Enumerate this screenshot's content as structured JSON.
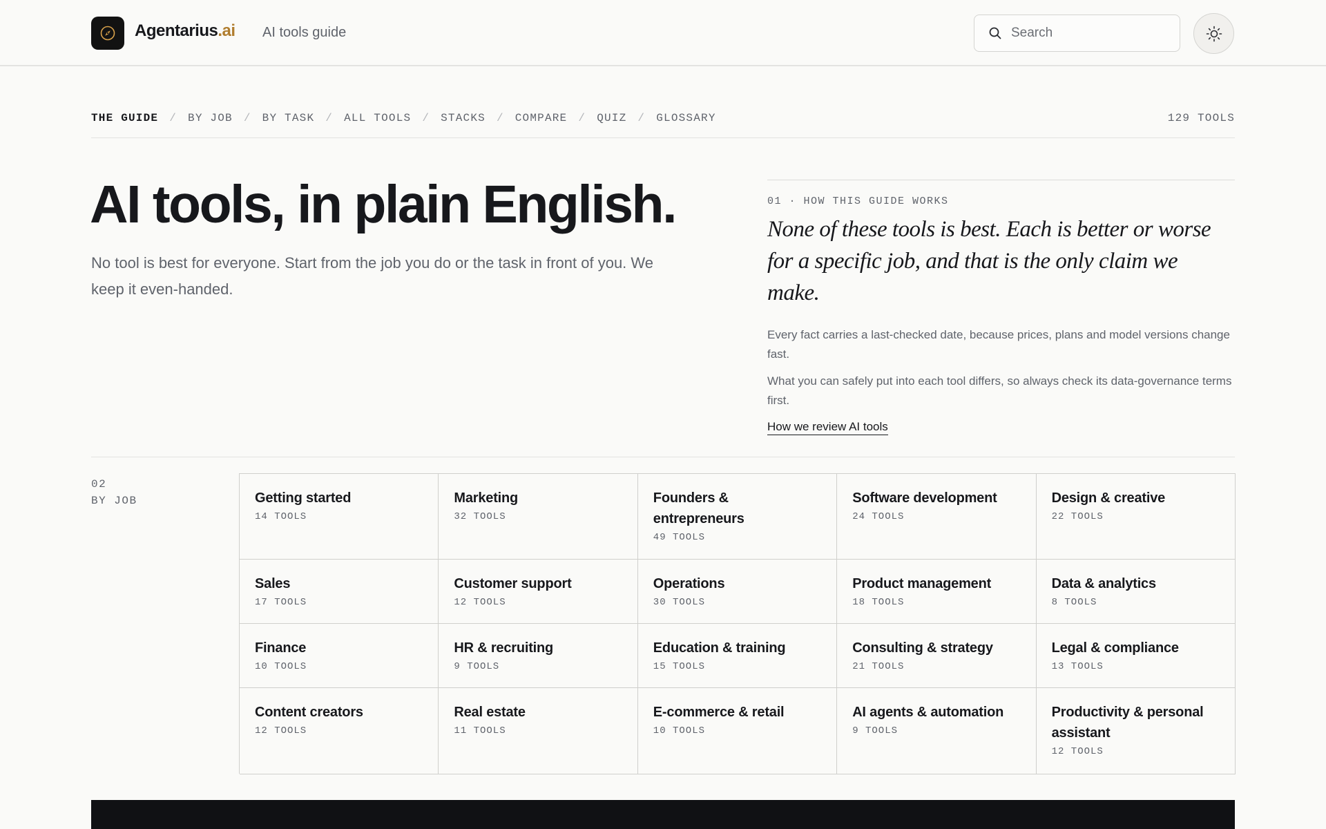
{
  "header": {
    "brand_name": "Agentarius",
    "brand_tld": ".ai",
    "subtitle": "AI tools guide",
    "search_placeholder": "Search",
    "logo_icon": "compass-icon",
    "search_icon": "search-icon",
    "theme_icon": "sun-icon"
  },
  "subnav": {
    "items": [
      {
        "label": "THE GUIDE",
        "active": true
      },
      {
        "label": "BY JOB",
        "active": false
      },
      {
        "label": "BY TASK",
        "active": false
      },
      {
        "label": "ALL TOOLS",
        "active": false
      },
      {
        "label": "STACKS",
        "active": false
      },
      {
        "label": "COMPARE",
        "active": false
      },
      {
        "label": "QUIZ",
        "active": false
      },
      {
        "label": "GLOSSARY",
        "active": false
      }
    ],
    "separator": "/",
    "tool_count": "129 TOOLS"
  },
  "hero": {
    "title": "AI tools, in plain English.",
    "lead": "No tool is best for everyone. Start from the job you do or the task in front of you. We keep it even-handed."
  },
  "how": {
    "eyebrow": "01 · HOW THIS GUIDE WORKS",
    "quote": "None of these tools is best. Each is better or worse for a specific job, and that is the only claim we make.",
    "p1": "Every fact carries a last-checked date, because prices, plans and model versions change fast.",
    "p2": "What you can safely put into each tool differs, so always check its data-governance terms first.",
    "link": "How we review AI tools"
  },
  "by_job": {
    "number": "02",
    "label": "BY JOB",
    "jobs": [
      {
        "name": "Getting started",
        "count": "14 TOOLS"
      },
      {
        "name": "Marketing",
        "count": "32 TOOLS"
      },
      {
        "name": "Founders & entrepreneurs",
        "count": "49 TOOLS"
      },
      {
        "name": "Software development",
        "count": "24 TOOLS"
      },
      {
        "name": "Design & creative",
        "count": "22 TOOLS"
      },
      {
        "name": "Sales",
        "count": "17 TOOLS"
      },
      {
        "name": "Customer support",
        "count": "12 TOOLS"
      },
      {
        "name": "Operations",
        "count": "30 TOOLS"
      },
      {
        "name": "Product management",
        "count": "18 TOOLS"
      },
      {
        "name": "Data & analytics",
        "count": "8 TOOLS"
      },
      {
        "name": "Finance",
        "count": "10 TOOLS"
      },
      {
        "name": "HR & recruiting",
        "count": "9 TOOLS"
      },
      {
        "name": "Education & training",
        "count": "15 TOOLS"
      },
      {
        "name": "Consulting & strategy",
        "count": "21 TOOLS"
      },
      {
        "name": "Legal & compliance",
        "count": "13 TOOLS"
      },
      {
        "name": "Content creators",
        "count": "12 TOOLS"
      },
      {
        "name": "Real estate",
        "count": "11 TOOLS"
      },
      {
        "name": "E-commerce & retail",
        "count": "10 TOOLS"
      },
      {
        "name": "AI agents & automation",
        "count": "9 TOOLS"
      },
      {
        "name": "Productivity & personal assistant",
        "count": "12 TOOLS"
      }
    ]
  },
  "colors": {
    "background": "#fafaf8",
    "text": "#17181c",
    "muted": "#5f636b",
    "accent": "#b07d2e",
    "dark": "#101114"
  }
}
